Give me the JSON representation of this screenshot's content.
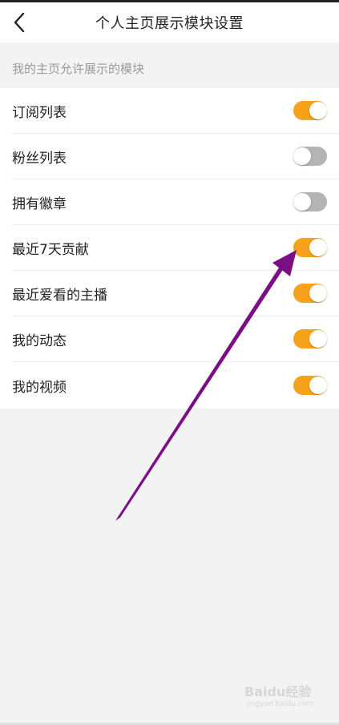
{
  "header": {
    "title": "个人主页展示模块设置"
  },
  "section": {
    "label": "我的主页允许展示的模块"
  },
  "modules": [
    {
      "label": "订阅列表",
      "enabled": true
    },
    {
      "label": "粉丝列表",
      "enabled": false
    },
    {
      "label": "拥有徽章",
      "enabled": false
    },
    {
      "label": "最近7天贡献",
      "enabled": true
    },
    {
      "label": "最近爱看的主播",
      "enabled": true
    },
    {
      "label": "我的动态",
      "enabled": true
    },
    {
      "label": "我的视频",
      "enabled": true
    }
  ],
  "colors": {
    "toggle_on": "#f7a21b",
    "toggle_off": "#b4b4b4",
    "arrow": "#7b0e84"
  },
  "watermark": {
    "brand": "Baidu经验",
    "domain": "jingyan.baidu.com"
  }
}
